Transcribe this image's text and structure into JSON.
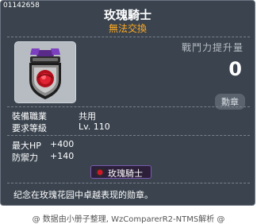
{
  "item": {
    "id": "01142658",
    "name": "玫瑰騎士",
    "trade_status": "無法交換",
    "power_label": "戰鬥力提升量",
    "power_value": "0",
    "category_badge": "勳章",
    "job_label": "裝備職業",
    "job_value": "共用",
    "level_label": "要求等級",
    "level_value": "Lv. 110",
    "stats": [
      {
        "label": "最大HP",
        "value": "+400"
      },
      {
        "label": "防禦力",
        "value": "+140"
      }
    ],
    "medal_tag": "玫瑰騎士",
    "description": "纪念在玫瑰花园中卓越表现的勋章。",
    "icon": "rose-knight-medal-icon"
  },
  "footer": {
    "text": "@ 数据由小册子整理, WzComparerR2-NTMS解析 @"
  },
  "colors": {
    "panel_bg": "#3a434e",
    "trade_status": "#ffaa22",
    "text": "#ffffff",
    "muted": "#b8bdc4"
  }
}
